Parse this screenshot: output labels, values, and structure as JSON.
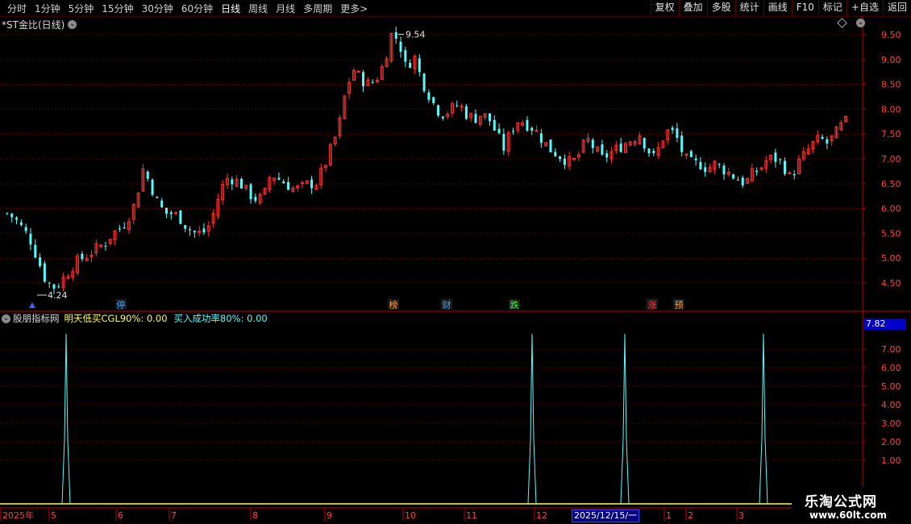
{
  "toolbar": {
    "periods": [
      "分时",
      "1分钟",
      "5分钟",
      "15分钟",
      "30分钟",
      "60分钟",
      "日线",
      "周线",
      "月线",
      "多周期",
      "更多"
    ],
    "active": "日线",
    "more_arrow": ">",
    "buttons": [
      "复权",
      "叠加",
      "多股",
      "统计",
      "画线",
      "F10",
      "标记",
      "+自选",
      "返回"
    ]
  },
  "chart": {
    "title": "*ST金比(日线)",
    "high_label": "9.54",
    "low_label": "4.24",
    "y_ticks": [
      "9.50",
      "9.00",
      "8.50",
      "8.00",
      "7.50",
      "7.00",
      "6.50",
      "6.00",
      "5.50",
      "5.00",
      "4.50"
    ],
    "events": [
      {
        "text": "停",
        "color": "#3aa0ff"
      },
      {
        "text": "榜",
        "color": "#ffa040"
      },
      {
        "text": "财",
        "color": "#40a0ff"
      },
      {
        "text": "跌",
        "color": "#40ff40"
      },
      {
        "text": "涨",
        "color": "#ff4040"
      },
      {
        "text": "预",
        "color": "#ffa040"
      }
    ]
  },
  "indicator": {
    "name": "股朋指标网",
    "s1_label": "明天低买CGL90%: 0.00",
    "s2_label": "买入成功率80%: 0.00",
    "last_value": "7.82",
    "y_ticks": [
      "7.00",
      "6.00",
      "5.00",
      "4.00",
      "3.00",
      "2.00",
      "1.00"
    ]
  },
  "x_axis": {
    "labels": [
      "2025年",
      "5",
      "6",
      "7",
      "8",
      "9",
      "10",
      "11",
      "12",
      "1",
      "2",
      "3"
    ],
    "cursor_date": "2025/12/15/一"
  },
  "watermark": {
    "line1": "乐淘公式网",
    "line2": "www.60lt.com"
  },
  "colors": {
    "up": "#ff3232",
    "down": "#54fcfc",
    "signal": "#54fcfc",
    "grid": "#7a0000",
    "axis": "#c00000"
  },
  "chart_data": {
    "type": "candlestick",
    "price_axis": [
      4.5,
      9.5
    ],
    "high": 9.54,
    "low": 4.24,
    "close_path": [
      5.9,
      5.8,
      5.6,
      5.4,
      5.0,
      4.6,
      4.4,
      4.5,
      4.7,
      4.9,
      5.0,
      5.1,
      5.2,
      5.3,
      5.5,
      5.6,
      5.8,
      6.1,
      6.8,
      6.5,
      6.1,
      5.9,
      5.9,
      5.8,
      5.6,
      5.5,
      5.5,
      5.7,
      6.2,
      6.6,
      6.6,
      6.5,
      6.3,
      6.2,
      6.2,
      6.7,
      6.6,
      6.5,
      6.4,
      6.4,
      6.5,
      6.5,
      6.8,
      7.2,
      7.6,
      8.4,
      8.8,
      8.6,
      8.5,
      8.6,
      8.9,
      9.5,
      9.4,
      8.8,
      9.1,
      8.6,
      8.3,
      8.0,
      7.9,
      8.0,
      8.1,
      7.9,
      7.8,
      7.9,
      7.8,
      7.5,
      7.2,
      7.6,
      7.8,
      7.7,
      7.6,
      7.4,
      7.2,
      7.1,
      7.0,
      6.9,
      7.1,
      7.4,
      7.2,
      7.0,
      7.1,
      7.2,
      7.3,
      7.4,
      7.5,
      7.2,
      7.0,
      7.4,
      7.6,
      7.4,
      7.0,
      6.9,
      6.9,
      6.8,
      6.9,
      6.8,
      6.7,
      6.6,
      6.5,
      6.7,
      6.8,
      7.0,
      7.0,
      6.9,
      6.6,
      6.9,
      7.1,
      7.3,
      7.4,
      7.3,
      7.5,
      7.7,
      7.82
    ],
    "signal_peaks": [
      {
        "x": "2025年5月",
        "value": 7.82
      },
      {
        "x": "2025年12月",
        "value": 7.82
      },
      {
        "x": "2026年1月",
        "value": 7.82
      },
      {
        "x": "2026年3月",
        "value": 7.82
      }
    ],
    "indicator_axis": [
      0,
      8
    ]
  }
}
